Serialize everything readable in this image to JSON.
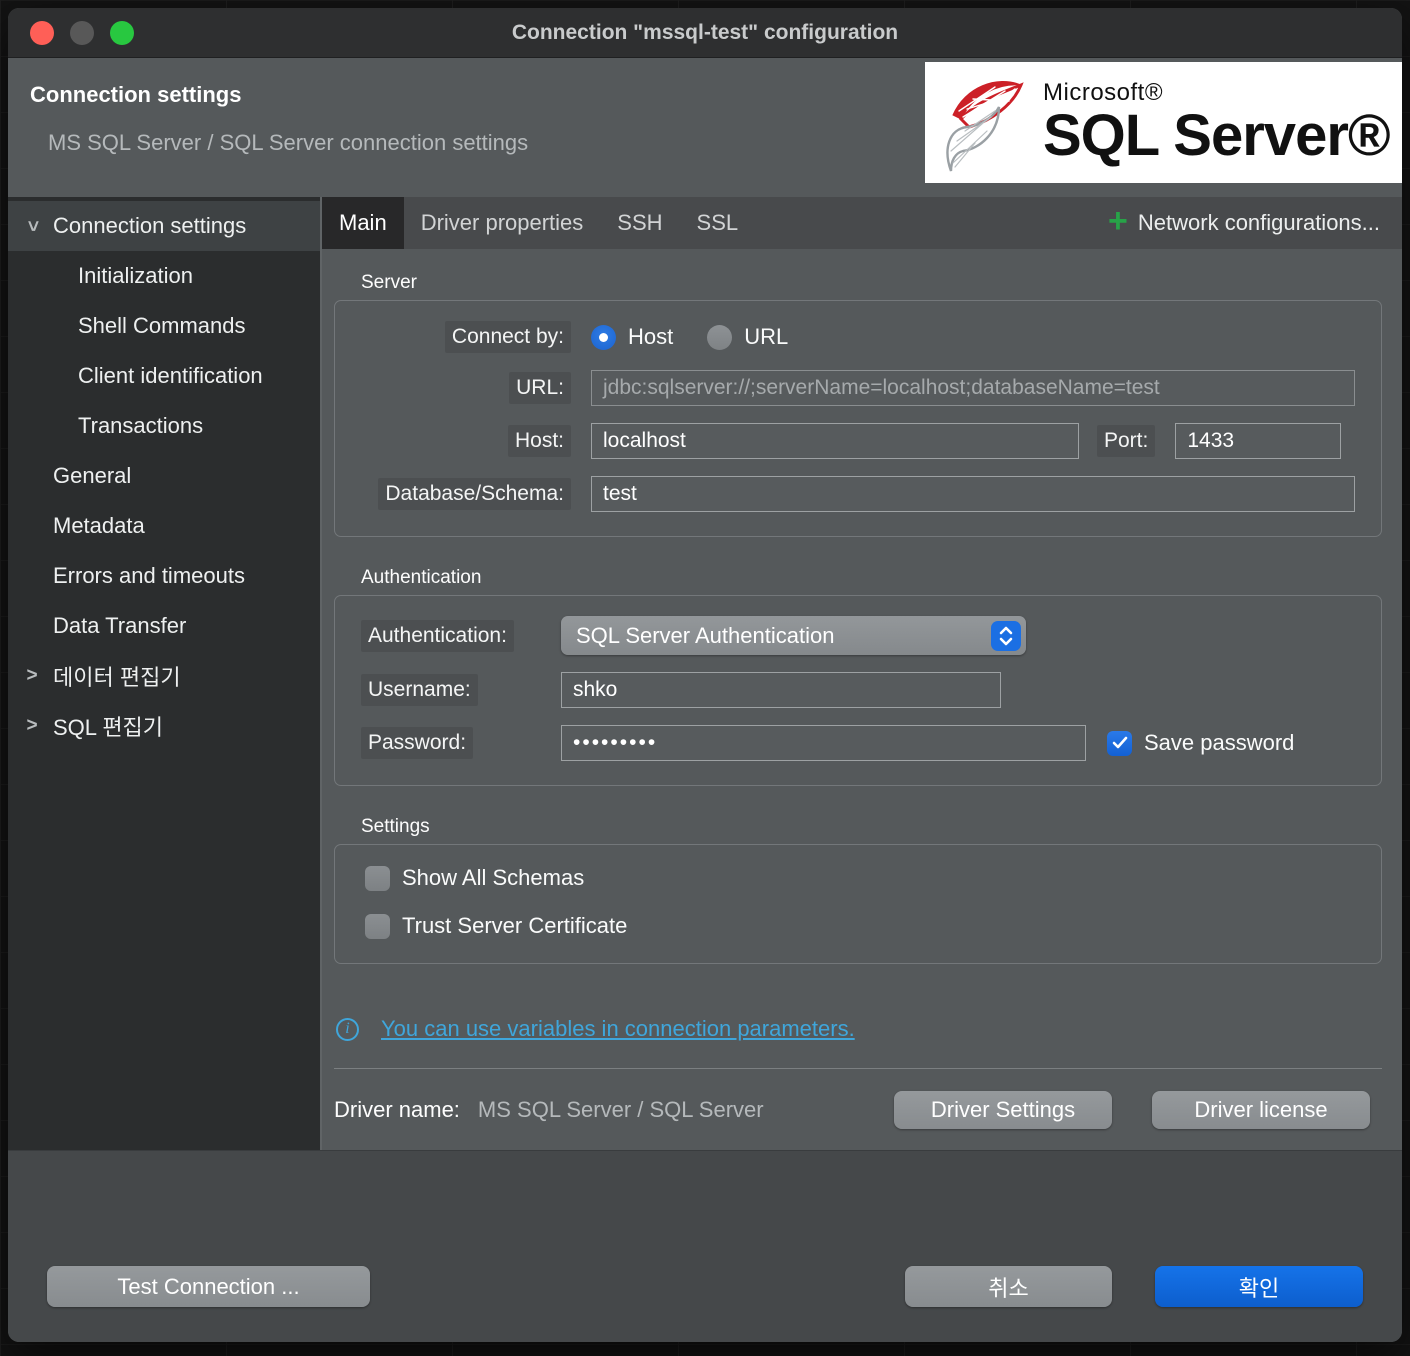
{
  "window": {
    "title": "Connection \"mssql-test\" configuration"
  },
  "header": {
    "title": "Connection settings",
    "subtitle": "MS SQL Server / SQL Server connection settings",
    "logo": {
      "brand": "Microsoft®",
      "product": "SQL Server®"
    }
  },
  "sidebar": {
    "items": [
      {
        "label": "Connection settings",
        "level": 0,
        "chevron": "down",
        "selected": true
      },
      {
        "label": "Initialization",
        "level": 1,
        "chevron": "none",
        "selected": false
      },
      {
        "label": "Shell Commands",
        "level": 1,
        "chevron": "none",
        "selected": false
      },
      {
        "label": "Client identification",
        "level": 1,
        "chevron": "none",
        "selected": false
      },
      {
        "label": "Transactions",
        "level": 1,
        "chevron": "none",
        "selected": false
      },
      {
        "label": "General",
        "level": 0,
        "chevron": "none",
        "selected": false
      },
      {
        "label": "Metadata",
        "level": 0,
        "chevron": "none",
        "selected": false
      },
      {
        "label": "Errors and timeouts",
        "level": 0,
        "chevron": "none",
        "selected": false
      },
      {
        "label": "Data Transfer",
        "level": 0,
        "chevron": "none",
        "selected": false
      },
      {
        "label": "데이터 편집기",
        "level": 0,
        "chevron": "right",
        "selected": false
      },
      {
        "label": "SQL 편집기",
        "level": 0,
        "chevron": "right",
        "selected": false
      }
    ]
  },
  "tabs": {
    "items": [
      {
        "label": "Main",
        "selected": true
      },
      {
        "label": "Driver properties",
        "selected": false
      },
      {
        "label": "SSH",
        "selected": false
      },
      {
        "label": "SSL",
        "selected": false
      }
    ],
    "network_config_label": "Network configurations..."
  },
  "server": {
    "group_label": "Server",
    "connect_by_label": "Connect by:",
    "host_radio_label": "Host",
    "url_radio_label": "URL",
    "selected_radio": "Host",
    "url_label": "URL:",
    "url_value": "jdbc:sqlserver://;serverName=localhost;databaseName=test",
    "host_label": "Host:",
    "host_value": "localhost",
    "port_label": "Port:",
    "port_value": "1433",
    "database_label": "Database/Schema:",
    "database_value": "test"
  },
  "authentication": {
    "group_label": "Authentication",
    "auth_label": "Authentication:",
    "auth_value": "SQL Server Authentication",
    "username_label": "Username:",
    "username_value": "shko",
    "password_label": "Password:",
    "password_masked": "•••••••••",
    "save_password_label": "Save password",
    "save_password_checked": true
  },
  "settings": {
    "group_label": "Settings",
    "options": [
      {
        "label": "Show All Schemas",
        "checked": false
      },
      {
        "label": "Trust Server Certificate",
        "checked": false
      }
    ]
  },
  "info": {
    "link_text": "You can use variables in connection parameters."
  },
  "driver": {
    "label": "Driver name:",
    "value": "MS SQL Server / SQL Server",
    "settings_button": "Driver Settings",
    "license_button": "Driver license"
  },
  "footer": {
    "test_button": "Test Connection ...",
    "cancel_button": "취소",
    "ok_button": "확인"
  },
  "colors": {
    "accent_blue": "#1b6fe3",
    "link_cyan": "#3fa6db",
    "plus_green": "#27a348",
    "traffic_red": "#ff5f57",
    "traffic_green": "#28c840"
  }
}
